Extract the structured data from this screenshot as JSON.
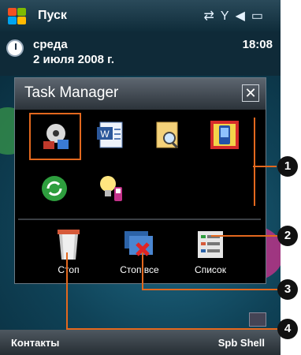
{
  "taskbar": {
    "start_label": "Пуск"
  },
  "today": {
    "weekday": "среда",
    "date": "2 июля 2008 г.",
    "time": "18:08"
  },
  "task_manager": {
    "title": "Task Manager",
    "close_glyph": "✕",
    "actions": [
      {
        "label": "Стоп"
      },
      {
        "label": "Стоп все"
      },
      {
        "label": "Список"
      }
    ]
  },
  "softkeys": {
    "left": "Контакты",
    "right": "Spb Shell"
  },
  "callouts": [
    "1",
    "2",
    "3",
    "4"
  ],
  "colors": {
    "accent": "#e3681e",
    "marker_bg": "#111111"
  }
}
